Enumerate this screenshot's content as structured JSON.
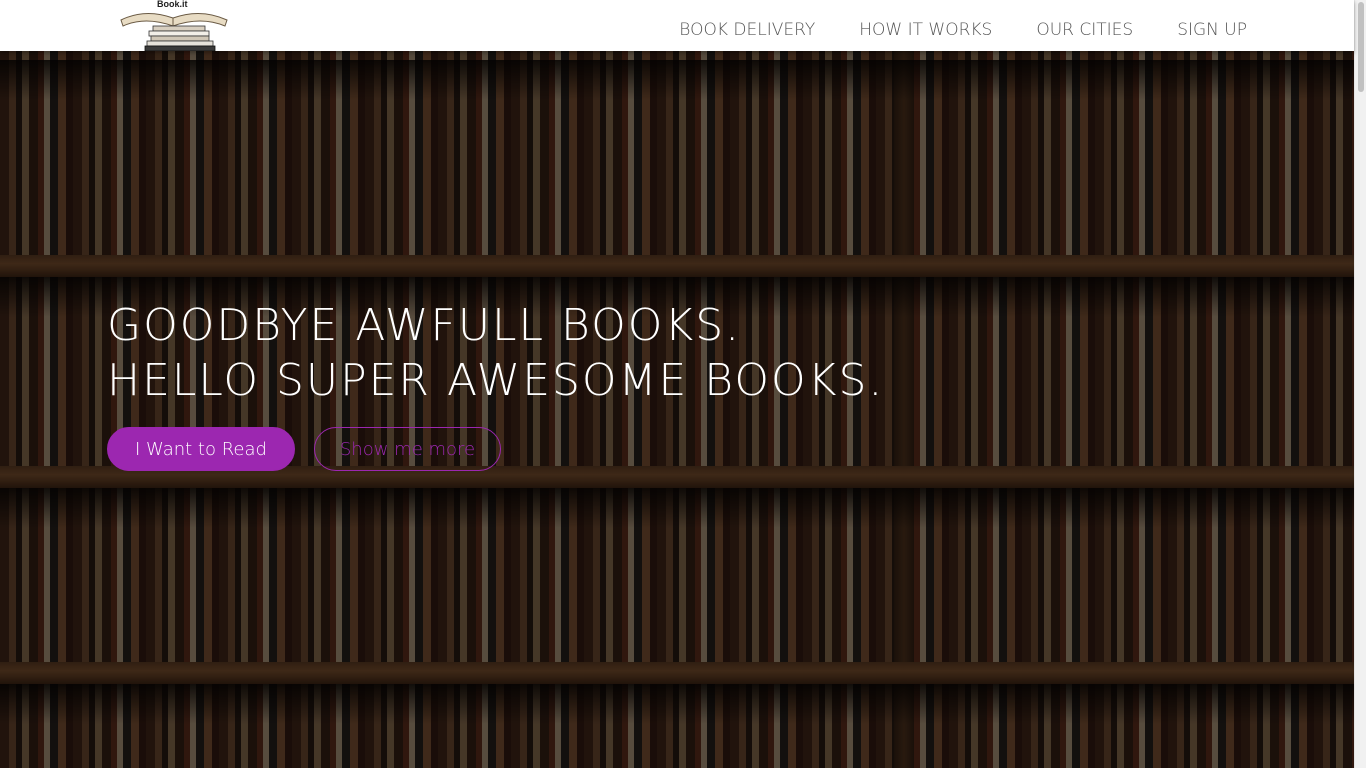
{
  "brand": {
    "logo_text": "Book.it"
  },
  "nav": {
    "items": [
      {
        "label": "BOOK DELIVERY"
      },
      {
        "label": "HOW IT WORKS"
      },
      {
        "label": "OUR CITIES"
      },
      {
        "label": "SIGN UP"
      }
    ]
  },
  "hero": {
    "line1": "GOODBYE AWFULL BOOKS.",
    "line2": "HELLO SUPER AWESOME BOOKS.",
    "primary_button": "I Want to Read",
    "secondary_button": "Show me more",
    "background_icon": "bookshelf-image"
  },
  "colors": {
    "accent": "#9c27b0",
    "nav_text": "#555555",
    "nav_background": "#ffffff",
    "hero_text": "#ffffff"
  }
}
